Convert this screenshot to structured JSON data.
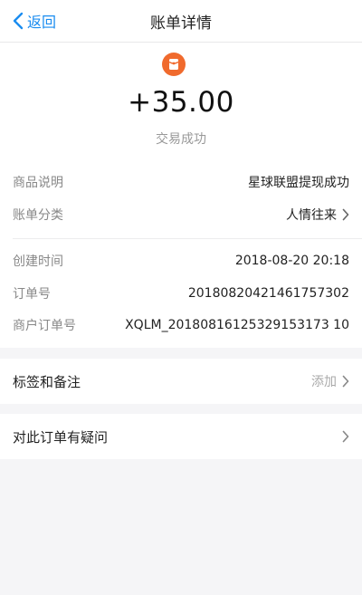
{
  "nav": {
    "back_label": "返回",
    "title": "账单详情"
  },
  "summary": {
    "amount": "+35.00",
    "status": "交易成功",
    "logo_icon": "red-envelope-icon",
    "logo_color": "#f06a2d"
  },
  "details": {
    "product_desc": {
      "label": "商品说明",
      "value": "星球联盟提现成功"
    },
    "category": {
      "label": "账单分类",
      "value": "人情往来"
    },
    "created": {
      "label": "创建时间",
      "value": "2018-08-20 20:18"
    },
    "order_no": {
      "label": "订单号",
      "value": "20180820421461757302"
    },
    "merchant_order_no": {
      "label": "商户订单号",
      "value": "XQLM_20180816125329153173 10"
    }
  },
  "tags": {
    "label": "标签和备注",
    "action": "添加"
  },
  "question": {
    "label": "对此订单有疑问"
  },
  "colors": {
    "accent": "#1a8cf0",
    "background": "#f5f5f7"
  }
}
